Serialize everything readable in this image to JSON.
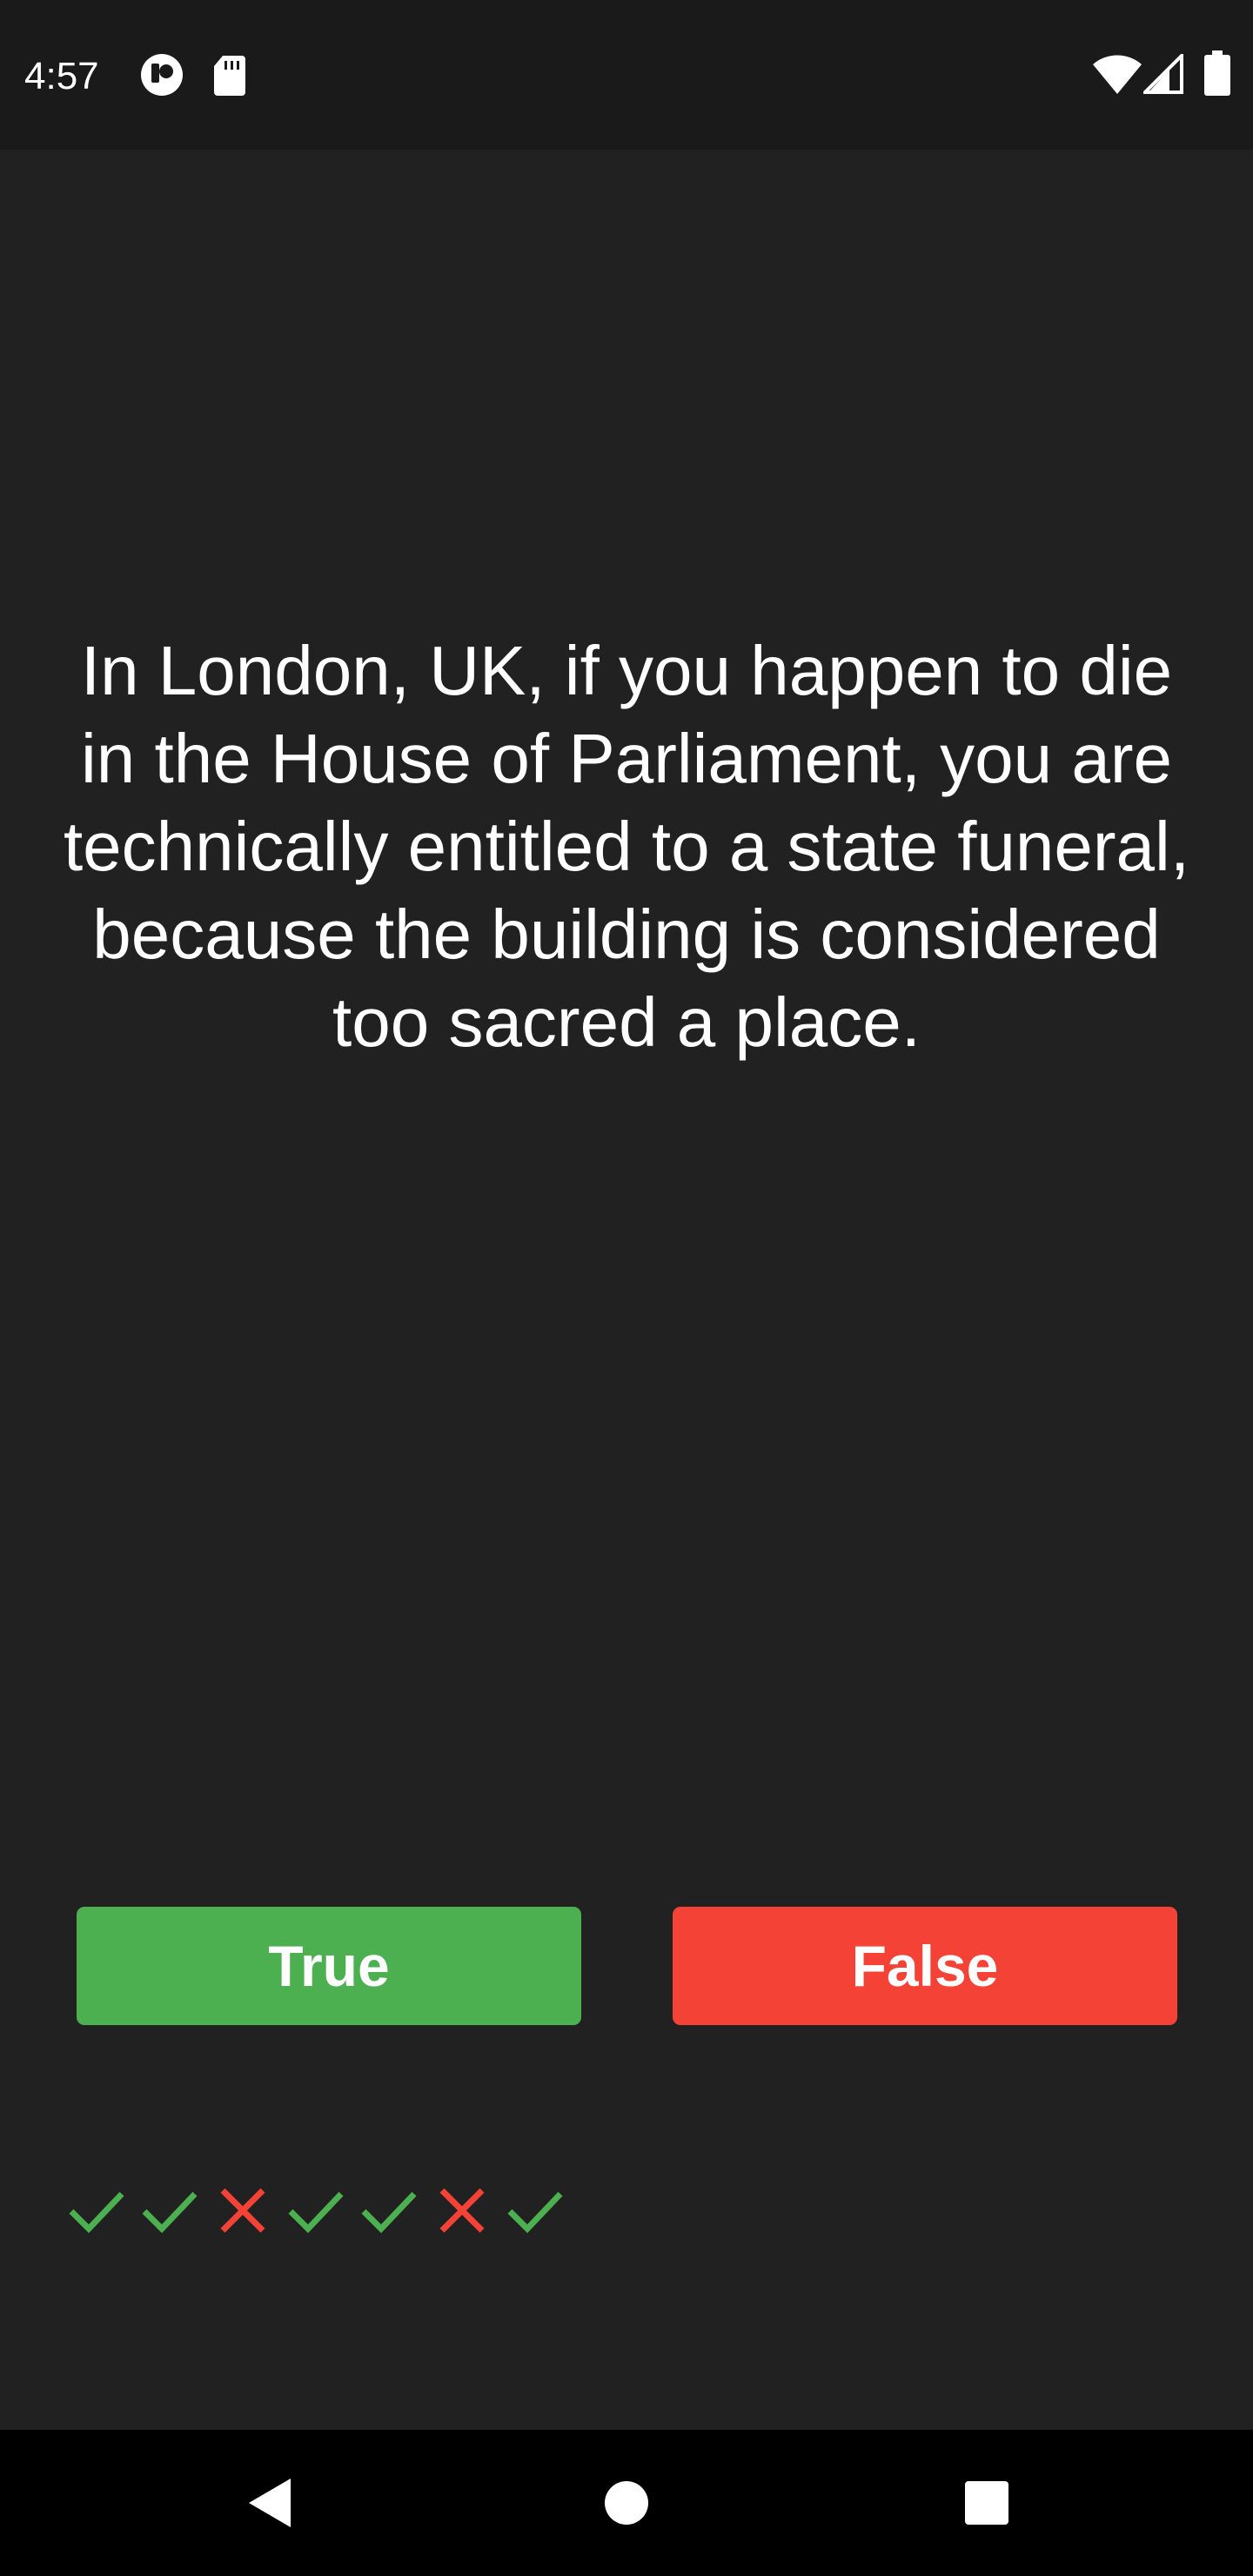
{
  "status_bar": {
    "time": "4:57",
    "icons": [
      "notification-app-icon",
      "sd-card-icon",
      "wifi-icon",
      "cellular-signal-icon",
      "battery-icon"
    ]
  },
  "quiz": {
    "question": "In London, UK, if you happen to die in the House of Parliament, you are technically entitled to a state funeral, because the building is considered too sacred a place.",
    "true_label": "True",
    "false_label": "False"
  },
  "history": [
    "correct",
    "correct",
    "wrong",
    "correct",
    "correct",
    "wrong",
    "correct"
  ],
  "colors": {
    "background": "#212121",
    "true_button": "#4caf50",
    "false_button": "#f44336",
    "correct_mark": "#4caf50",
    "wrong_mark": "#f44336"
  },
  "nav_bar": {
    "buttons": [
      "back-icon",
      "home-icon",
      "recents-icon"
    ]
  }
}
